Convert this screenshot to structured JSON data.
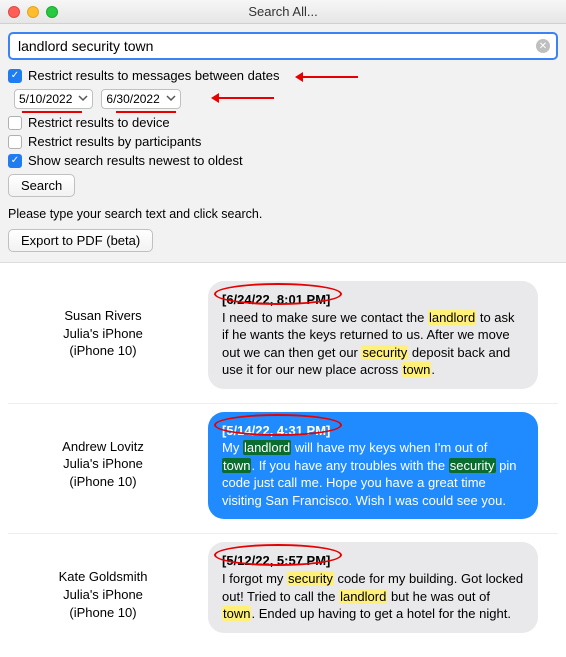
{
  "window": {
    "title": "Search All..."
  },
  "search": {
    "query": "landlord security town"
  },
  "options": {
    "restrict_dates_label": "Restrict results to messages between dates",
    "restrict_dates_checked": true,
    "date_from": "5/10/2022",
    "date_to": "6/30/2022",
    "restrict_device_label": "Restrict results to device",
    "restrict_device_checked": false,
    "restrict_participants_label": "Restrict results by participants",
    "restrict_participants_checked": false,
    "newest_first_label": "Show search results newest to oldest",
    "newest_first_checked": true,
    "search_button": "Search",
    "hint": "Please type your search text and click search.",
    "export_button": "Export to PDF (beta)"
  },
  "results": [
    {
      "contact": "Susan Rivers",
      "device": "Julia's iPhone",
      "model": "(iPhone 10)",
      "timestamp": "[6/24/22, 8:01 PM]",
      "style": "grey",
      "text_pre": "I need to make sure we contact the ",
      "kw1": "landlord",
      "text_mid1": " to ask if he wants the keys returned to us. After we move out we can then get our ",
      "kw2": "security",
      "text_mid2": " deposit back and use it for our new place across ",
      "kw3": "town",
      "text_post": "."
    },
    {
      "contact": "Andrew Lovitz",
      "device": "Julia's iPhone",
      "model": "(iPhone 10)",
      "timestamp": "[5/14/22, 4:31 PM]",
      "style": "blue",
      "text_pre": "My ",
      "kw1": "landlord",
      "text_mid1": " will have my keys when I'm out of ",
      "kw2": "town",
      "text_mid2": ". If you have any troubles with the ",
      "kw3": "security",
      "text_mid3": " pin code just call me. Hope you have a great time visiting San Francisco. Wish I was could see you.",
      "text_post": ""
    },
    {
      "contact": "Kate Goldsmith",
      "device": "Julia's iPhone",
      "model": "(iPhone 10)",
      "timestamp": "[5/12/22, 5:57 PM]",
      "style": "grey",
      "text_pre": "I forgot my ",
      "kw1": "security",
      "text_mid1": " code for my building. Got locked out! Tried to call the ",
      "kw2": "landlord",
      "text_mid2": " but he was out of ",
      "kw3": "town",
      "text_post": ". Ended up having to get a hotel for the night."
    }
  ]
}
